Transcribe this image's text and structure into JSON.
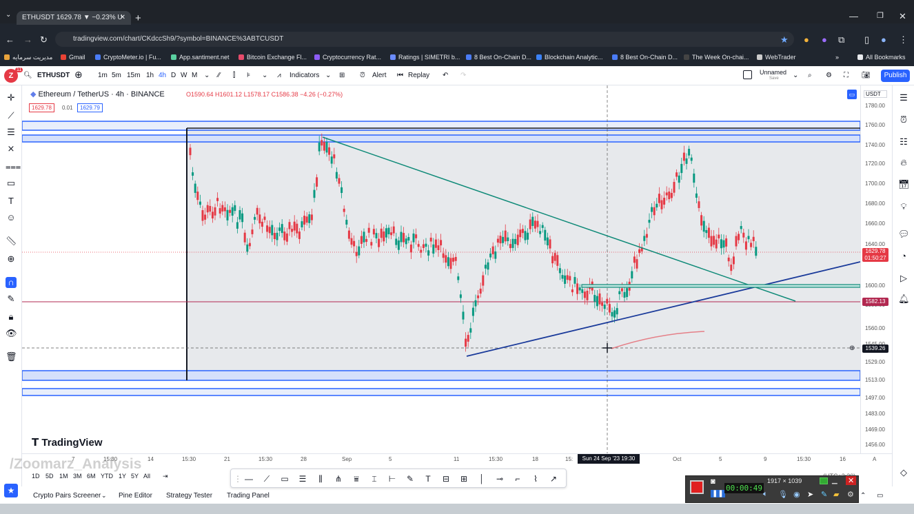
{
  "browser": {
    "tab_title": "ETHUSDT 1629.78 ▼ −0.23% U",
    "url": "tradingview.com/chart/CKdccSh9/?symbol=BINANCE%3ABTCUSDT",
    "bookmarks": [
      {
        "label": "مدیریت سرمایه",
        "color": "#e8a33c"
      },
      {
        "label": "Gmail",
        "color": "#ea4335"
      },
      {
        "label": "CryptoMeter.io | Fu...",
        "color": "#4a7cf6"
      },
      {
        "label": "App.santiment.net",
        "color": "#5ad1a1"
      },
      {
        "label": "Bitcoin Exchange Fl...",
        "color": "#e64b6b"
      },
      {
        "label": "Cryptocurrency Rat...",
        "color": "#8c5cf6"
      },
      {
        "label": "Ratings | SIMETRI b...",
        "color": "#6b8cff"
      },
      {
        "label": "8 Best On-Chain D...",
        "color": "#4a7cf6"
      },
      {
        "label": "Blockchain Analytic...",
        "color": "#3b82f6"
      },
      {
        "label": "8 Best On-Chain D...",
        "color": "#4a7cf6"
      },
      {
        "label": "The Week On-chai...",
        "color": "#222222"
      },
      {
        "label": "WebTrader",
        "color": "#cccccc"
      }
    ],
    "all_bookmarks": "All Bookmarks"
  },
  "toolbar": {
    "symbol": "ETHUSDT",
    "intervals": [
      "1m",
      "5m",
      "15m",
      "1h",
      "4h",
      "D",
      "W",
      "M"
    ],
    "active_interval": "4h",
    "indicators": "Indicators",
    "alert": "Alert",
    "replay": "Replay",
    "layout_name": "Unnamed",
    "layout_sub": "Save",
    "publish": "Publish",
    "avatar_badge": "11"
  },
  "legend": {
    "title": "Ethereum / TetherUS · 4h · BINANCE",
    "ohlc": "O1590.64  H1601.12  L1578.17  C1586.38  −4.26 (−0.27%)",
    "bid": "1629.78",
    "spread": "0.01",
    "ask": "1629.79"
  },
  "price_scale": {
    "currency": "USDT",
    "ticks": [
      "1780.00",
      "1760.00",
      "1740.00",
      "1720.00",
      "1700.00",
      "1680.00",
      "1660.00",
      "1640.00",
      "1600.00",
      "1580.00",
      "1560.00",
      "1545.00",
      "1529.00",
      "1513.00",
      "1497.00",
      "1483.00",
      "1469.00",
      "1456.00"
    ],
    "last_price": "1629.78",
    "countdown": "01:50:27",
    "line_price": "1582.13",
    "cursor_price": "1539.26"
  },
  "time_axis": {
    "ticks": [
      "7",
      "15:30",
      "14",
      "15:30",
      "21",
      "15:30",
      "28",
      "Sep",
      "5",
      "11",
      "15:30",
      "18",
      "15:",
      "Oct",
      "5",
      "9",
      "15:30",
      "16"
    ],
    "cursor_label": "Sun 24 Sep '23  19:30",
    "corner": "A"
  },
  "ranges": [
    "1D",
    "5D",
    "1M",
    "3M",
    "6M",
    "YTD",
    "1Y",
    "5Y",
    "All"
  ],
  "bottom_tabs": [
    "Crypto Pairs Screener",
    "Pine Editor",
    "Strategy Tester",
    "Trading Panel"
  ],
  "timezone": "(UTC+3:30)",
  "branding": "TradingView",
  "watermark": "/Zoomarz_Analysis",
  "recorder": {
    "time": "00:00:49",
    "resolution": "1917 × 1039"
  },
  "colors": {
    "up": "#089981",
    "down": "#e53945",
    "accent": "#2962ff",
    "zone": "#2962ff"
  }
}
